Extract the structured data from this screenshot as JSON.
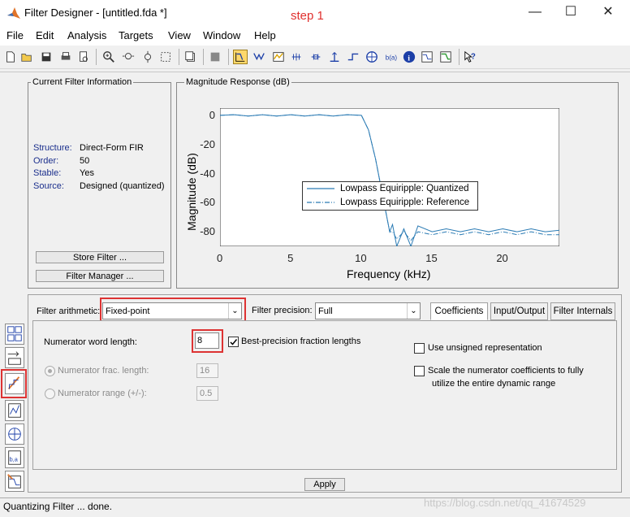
{
  "window": {
    "title": "Filter Designer -  [untitled.fda *]",
    "annotation": "step 1",
    "minimize": "—",
    "maximize": "☐",
    "close": "✕"
  },
  "menu": [
    "File",
    "Edit",
    "Analysis",
    "Targets",
    "View",
    "Window",
    "Help"
  ],
  "info_panel": {
    "title": "Current Filter Information",
    "rows": [
      {
        "label": "Structure:",
        "value": "Direct-Form FIR"
      },
      {
        "label": "Order:",
        "value": "50"
      },
      {
        "label": "Stable:",
        "value": "Yes"
      },
      {
        "label": "Source:",
        "value": "Designed (quantized)"
      }
    ],
    "store_button": "Store Filter ...",
    "manager_button": "Filter Manager ..."
  },
  "magnitude_panel": {
    "title": "Magnitude Response (dB)"
  },
  "chart_data": {
    "type": "line",
    "xlabel": "Frequency (kHz)",
    "ylabel": "Magnitude (dB)",
    "xlim": [
      0,
      24
    ],
    "ylim": [
      -90,
      5
    ],
    "xticks": [
      "0",
      "5",
      "10",
      "15",
      "20"
    ],
    "yticks": [
      "0",
      "-20",
      "-40",
      "-60",
      "-80"
    ],
    "legend_placement": "center",
    "colors": {
      "line": "#2b7bb4"
    },
    "series": [
      {
        "name": "Lowpass Equiripple: Quantized",
        "style": "solid",
        "x": [
          0,
          1,
          2,
          3,
          4,
          5,
          6,
          7,
          8,
          9,
          10,
          10.5,
          11,
          11.5,
          12,
          12.2,
          12.5,
          13,
          13.5,
          14,
          15,
          16,
          17,
          18,
          19,
          20,
          21,
          22,
          23,
          24
        ],
        "y": [
          0,
          0.5,
          -0.5,
          0.5,
          -0.5,
          0.5,
          -0.5,
          0.5,
          -0.5,
          0.5,
          0,
          -10,
          -30,
          -55,
          -80,
          -75,
          -90,
          -78,
          -90,
          -76,
          -80,
          -78,
          -80,
          -78,
          -80,
          -78,
          -80,
          -78,
          -80,
          -79
        ]
      },
      {
        "name": "Lowpass Equiripple: Reference",
        "style": "dashdot",
        "x": [
          0,
          1,
          2,
          3,
          4,
          5,
          6,
          7,
          8,
          9,
          10,
          10.5,
          11,
          11.5,
          12,
          12.2,
          12.5,
          13,
          13.5,
          14,
          15,
          16,
          17,
          18,
          19,
          20,
          21,
          22,
          23,
          24
        ],
        "y": [
          0,
          0.5,
          -0.5,
          0.5,
          -0.5,
          0.5,
          -0.5,
          0.5,
          -0.5,
          0.5,
          0,
          -10,
          -30,
          -55,
          -80,
          -80,
          -85,
          -80,
          -86,
          -80,
          -82,
          -80,
          -82,
          -80,
          -82,
          -80,
          -82,
          -80,
          -82,
          -82
        ]
      }
    ]
  },
  "quant": {
    "arith_label": "Filter arithmetic:",
    "arith_value": "Fixed-point",
    "precision_label": "Filter precision:",
    "precision_value": "Full",
    "tabs": [
      "Coefficients",
      "Input/Output",
      "Filter Internals"
    ],
    "num_word_label": "Numerator word length:",
    "num_word_value": "8",
    "best_precision": "Best-precision fraction lengths",
    "num_frac_label": "Numerator frac. length:",
    "num_frac_value": "16",
    "num_range_label": "Numerator range (+/-):",
    "num_range_value": "0.5",
    "unsigned_label": "Use unsigned representation",
    "scale_label_1": "Scale the numerator coefficients to fully",
    "scale_label_2": "utilize the entire dynamic range",
    "apply_button": "Apply"
  },
  "status": {
    "text": "Quantizing Filter ... done.",
    "watermark": "https://blog.csdn.net/qq_41674529"
  },
  "icons": [
    "new-file-icon",
    "open-folder-icon",
    "save-icon",
    "print-icon",
    "print-preview-icon",
    "zoom-in-icon",
    "zoom-x-icon",
    "zoom-y-icon",
    "full-view-icon",
    "new-figure-icon",
    "grid-icon",
    "filter-specs-icon",
    "magnitude-response-icon",
    "phase-response-icon",
    "group-delay-icon",
    "phase-delay-icon",
    "impulse-response-icon",
    "step-response-icon",
    "pole-zero-icon",
    "coefficients-icon",
    "filter-info-icon",
    "magnitude-estimate-icon",
    "round-off-noise-icon",
    "whats-this-icon"
  ]
}
